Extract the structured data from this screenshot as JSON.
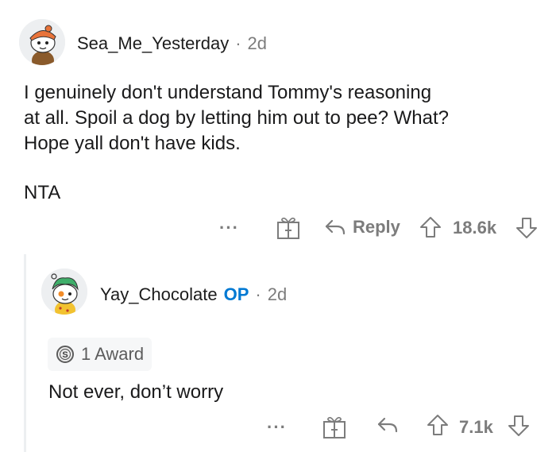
{
  "comment": {
    "username": "Sea_Me_Yesterday",
    "separator": "·",
    "age": "2d",
    "body_lines": [
      "I genuinely don't understand Tommy's reasoning",
      "at all. Spoil a dog by letting him out to pee? What?",
      "Hope yall don't have kids."
    ],
    "body_last": "NTA",
    "more_label": "···",
    "reply_label": "Reply",
    "score": "18.6k",
    "icons": [
      "more-icon",
      "gift-icon",
      "reply-icon",
      "upvote-icon",
      "downvote-icon"
    ]
  },
  "reply": {
    "username": "Yay_Chocolate",
    "op_badge": "OP",
    "separator": "·",
    "age": "2d",
    "award_label": "1 Award",
    "body": "Not ever, don’t worry",
    "more_label": "···",
    "score": "7.1k",
    "icons": [
      "award-coin-icon",
      "more-icon",
      "gift-icon",
      "reply-icon",
      "upvote-icon",
      "downvote-icon"
    ]
  },
  "colors": {
    "text": "#1a1a1b",
    "meta": "#7c7c7c",
    "op": "#0079d3",
    "thread_line": "#edeff1"
  }
}
